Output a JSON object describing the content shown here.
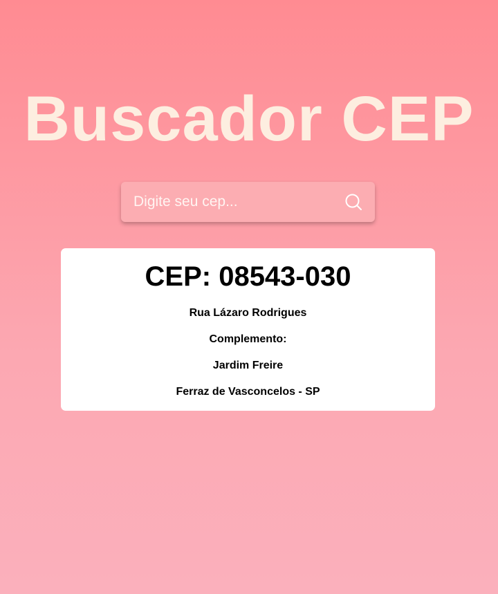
{
  "header": {
    "title": "Buscador CEP"
  },
  "search": {
    "placeholder": "Digite seu cep...",
    "value": "",
    "button_icon": "search-icon"
  },
  "result": {
    "cep_title": "CEP: 08543-030",
    "street": "Rua Lázaro Rodrigues",
    "complement": "Complemento:",
    "neighborhood": "Jardim Freire",
    "city_state": "Ferraz de Vasconcelos - SP"
  },
  "colors": {
    "background_top": "#ff8b92",
    "background_bottom": "#fbb0bc",
    "title": "#fdeee0",
    "search_bg": "#fcadb2",
    "card_bg": "#ffffff"
  }
}
